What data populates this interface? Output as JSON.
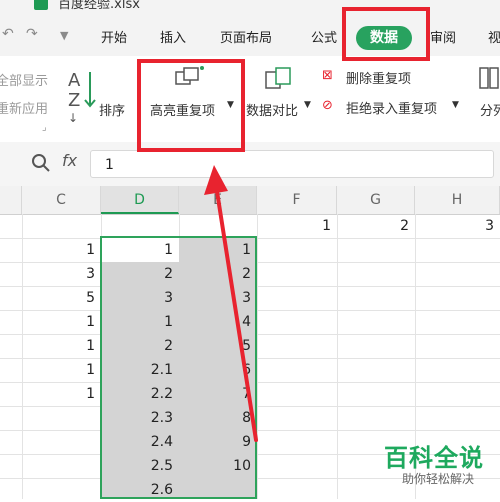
{
  "title": {
    "filename": "百度经验.xlsx"
  },
  "tabs": {
    "start": "开始",
    "insert": "插入",
    "page_layout": "页面布局",
    "formula": "公式",
    "data": "数据",
    "review": "审阅",
    "view": "视"
  },
  "ribbon": {
    "show_all": "全部显示",
    "reapply": "重新应用",
    "sort": "排序",
    "highlight_dup": "高亮重复项",
    "data_compare": "数据对比",
    "delete_dup": "删除重复项",
    "reject_dup": "拒绝录入重复项",
    "split": "分列"
  },
  "formula_bar": {
    "fx": "fx",
    "value": "1"
  },
  "grid": {
    "columns": [
      "C",
      "D",
      "E",
      "F",
      "G",
      "H"
    ],
    "selected_column": "D",
    "row1": {
      "F": "1",
      "G": "2",
      "H": "3"
    },
    "col_c": [
      "1",
      "3",
      "5",
      "1",
      "1",
      "1",
      "1"
    ],
    "col_d": [
      "1",
      "2",
      "3",
      "1",
      "2",
      "2.1",
      "2.2",
      "2.3",
      "2.4",
      "2.5",
      "2.6"
    ],
    "col_e": [
      "1",
      "2",
      "3",
      "4",
      "5",
      "6",
      "7",
      "8",
      "9",
      "10"
    ]
  },
  "watermark": {
    "brand": "百科全说",
    "sub": "助你轻松解决"
  },
  "colors": {
    "accent": "#28a25f",
    "annotation": "#e8232f",
    "selection": "#d4d4d4"
  }
}
